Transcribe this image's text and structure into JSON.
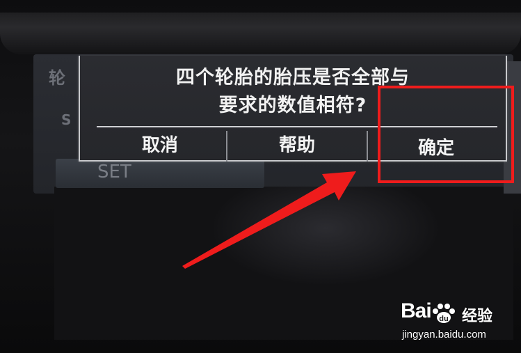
{
  "dialog": {
    "question_line1": "四个轮胎的胎压是否全部与",
    "question_line2": "要求的数值相符?",
    "buttons": {
      "cancel": "取消",
      "help": "帮助",
      "confirm": "确定"
    }
  },
  "background_menu": {
    "item1": "轮",
    "item2": "S",
    "item3": "SET"
  },
  "annotation": {
    "highlight_color": "#ef1c1c",
    "arrow_color": "#ef1c1c"
  },
  "watermark": {
    "logo": "Bai",
    "logo_suffix": "经验",
    "url": "jingyan.baidu.com"
  }
}
